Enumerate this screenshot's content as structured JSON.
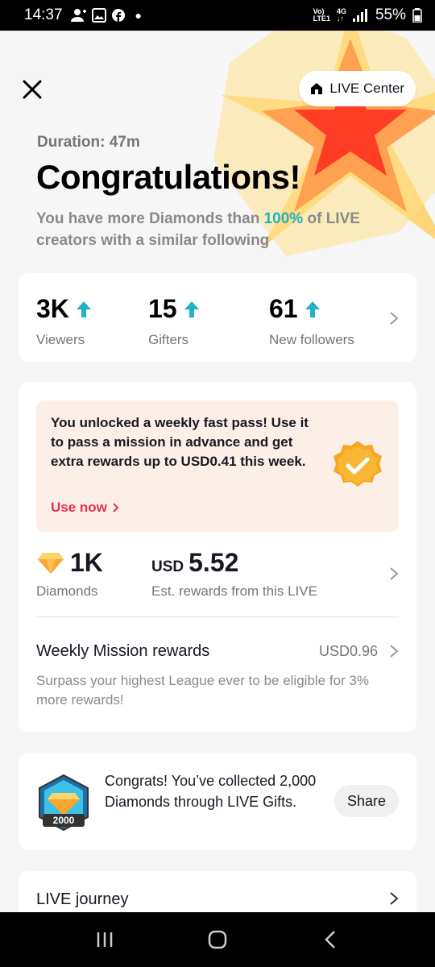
{
  "status_bar": {
    "time": "14:37",
    "network_top": "Vo)",
    "network_bottom": "LTE1",
    "net_type": "4G",
    "battery": "55%"
  },
  "header": {
    "live_center_label": "LIVE Center",
    "duration": "Duration: 47m",
    "title": "Congratulations!",
    "subtitle_pre": "You have more Diamonds than ",
    "subtitle_highlight": "100%",
    "subtitle_post": " of LIVE creators with a similar following"
  },
  "stats": [
    {
      "value": "3K",
      "label": "Viewers"
    },
    {
      "value": "15",
      "label": "Gifters"
    },
    {
      "value": "61",
      "label": "New followers"
    }
  ],
  "fast_pass": {
    "text": "You unlocked a weekly fast pass! Use it to pass a mission in advance and get extra rewards up to USD0.41 this week.",
    "use_now": "Use now"
  },
  "rewards": {
    "diamonds_value": "1K",
    "diamonds_label": "Diamonds",
    "usd_currency": "USD",
    "usd_value": "5.52",
    "usd_label": "Est. rewards from this LIVE"
  },
  "weekly": {
    "title": "Weekly Mission rewards",
    "value": "USD0.96",
    "description": "Surpass your highest League ever to be eligible for 3% more rewards!"
  },
  "achievement": {
    "badge_number": "2000",
    "text": "Congrats! You’ve collected 2,000 Diamonds through LIVE Gifts.",
    "share_label": "Share"
  },
  "journey": {
    "title": "LIVE journey"
  },
  "colors": {
    "accent_cyan": "#20b2c5",
    "accent_red": "#e8304f",
    "hero_orange": "#ff6a3d",
    "hero_yellow": "#ffd36b"
  }
}
